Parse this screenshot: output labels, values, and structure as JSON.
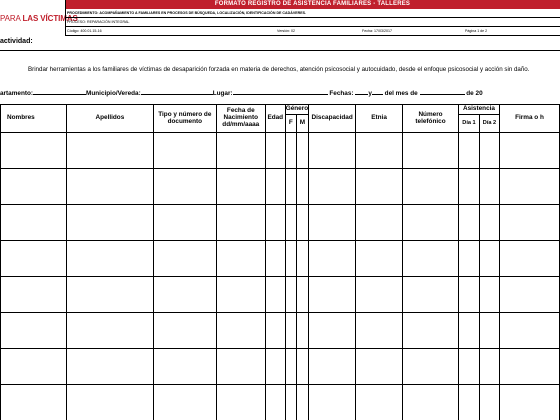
{
  "logo": {
    "prefix": "PARA ",
    "name": "LAS VÍCTIMAS"
  },
  "header": {
    "title": "FORMATO REGISTRO DE ASISTENCIA FAMILIARES - TALLERES",
    "procedure": "PROCEDIMIENTO: ACOMPAÑAMIENTO A FAMILIARES EN PROCESOS DE BÚSQUEDA, LOCALIZACIÓN, IDENTIFICACIÓN DE CADÁVERES.",
    "process": "PROCESO: REPARACIÓN INTEGRAL",
    "code": "Código: 400.01.15-16",
    "version": "Versión: 02",
    "date": "Fecha: 17/03/2017",
    "page": "Página 1 de 2"
  },
  "activity_label": "actividad:",
  "purpose": "Brindar herramientas a los familiares de víctimas de desaparición forzada en materia de derechos, atención psicosocial y autocuidado, desde el enfoque psicosocial y acción sin daño.",
  "location": {
    "department": "artamento:",
    "municipality": "Municipio/Vereda:",
    "place": "Lugar:",
    "dates": "Fechas:",
    "and": "y",
    "month": "del mes de",
    "year_prefix": "de 20"
  },
  "columns": {
    "names": "Nombres",
    "surnames": "Apellidos",
    "doc": "Tipo y número de documento",
    "birth": "Fecha de Nacimiento dd/mm/aaaa",
    "age": "Edad",
    "gender": "Género",
    "gender_f": "F",
    "gender_m": "M",
    "disability": "Discapacidad",
    "ethnicity": "Etnia",
    "phone": "Número telefónico",
    "attendance": "Asistencia",
    "day1": "Día 1",
    "day2": "Día 2",
    "signature": "Firma o h"
  },
  "row_count": 8
}
